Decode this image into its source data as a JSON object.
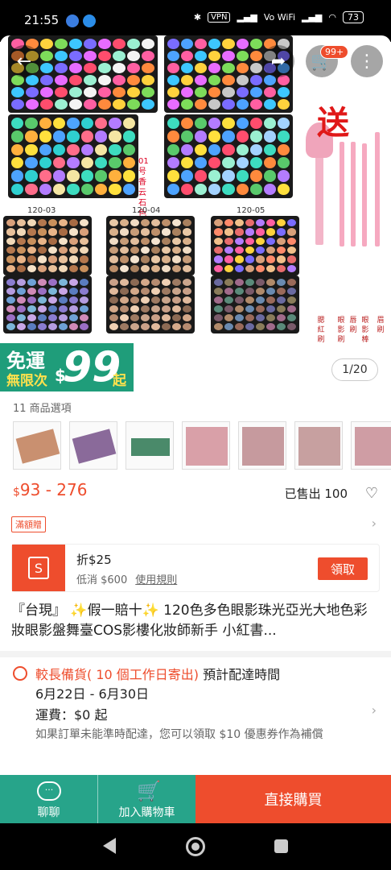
{
  "status": {
    "time": "21:55",
    "vpn": "VPN",
    "volte": "Vo WiFi",
    "battery": "73"
  },
  "hero": {
    "cart_badge": "99+",
    "gift_text": "送",
    "palette_labels": [
      "120-03",
      "120-04",
      "120-05"
    ],
    "vertical_text": "01号香云石色",
    "brush_labels": [
      "腮紅刷",
      "眼影刷",
      "唇刷",
      "眼影棒",
      "眉刷"
    ],
    "pager": "1/20"
  },
  "promo": {
    "line1": "免運",
    "line2": "無限次",
    "dollar": "$",
    "amount": "99",
    "suffix": "起"
  },
  "options": {
    "label": "11 商品選項",
    "count": 7
  },
  "price": {
    "currency": "$",
    "range": "93 - 276",
    "sold_label": "已售出",
    "sold_count": "100"
  },
  "tag": "滿額贈",
  "coupon": {
    "title": "折$25",
    "min_label": "低消 $600",
    "rules_link": "使用規則",
    "claim_label": "領取"
  },
  "title": "『台現』 ✨假一賠十✨ 120色多色眼影珠光亞光大地色彩妝眼影盤舞臺COS影樓化妝師新手 小紅書...",
  "shipping": {
    "leadtime": "較長備貨( 10 個工作日寄出)",
    "estimate_label": "預計配達時間",
    "date_range": "6月22日 - 6月30日",
    "fee": "運費：$0 起",
    "compensation": "如果訂單未能準時配達，您可以領取 $10 優惠券作為補償"
  },
  "bottom": {
    "chat_label": "聊聊",
    "cart_label": "加入購物車",
    "buy_label": "直接購買"
  }
}
